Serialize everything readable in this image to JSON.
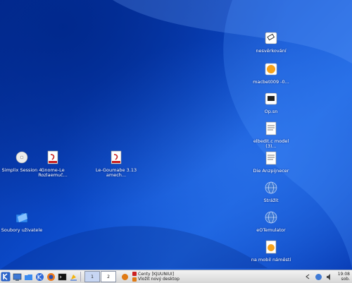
{
  "desktop": {
    "icons": [
      {
        "id": "dvd",
        "name": "dvd-drive-icon",
        "label": "Simplix Session 4",
        "color": "#e8e8e8"
      },
      {
        "id": "pdf1",
        "name": "pdf-document-icon",
        "label": "Gnome-Le Rozlaemuč...",
        "color": "#c81e1e"
      },
      {
        "id": "pdf2",
        "name": "pdf-document-icon",
        "label": "Le-Goumabe 3.13 amech...",
        "color": "#c81e1e"
      },
      {
        "id": "folder",
        "name": "folder-icon",
        "label": "Soubory uživatele",
        "color": "#4aa0ff"
      },
      {
        "id": "eraser",
        "name": "eraser-app-icon",
        "label": "nesvěrkování",
        "color": "#ffffff"
      },
      {
        "id": "mac",
        "name": "hand-document-icon",
        "label": "macbet009 -0...",
        "color": "#f6a21a"
      },
      {
        "id": "disk",
        "name": "disk-image-icon",
        "label": "Op.sn",
        "color": "#ffffff"
      },
      {
        "id": "text1",
        "name": "text-document-icon",
        "label": "elbedit.c model (3)...",
        "color": "#ffffff"
      },
      {
        "id": "text2",
        "name": "text-document-icon",
        "label": "Die Anzpijnecer",
        "color": "#ffffff"
      },
      {
        "id": "globe1",
        "name": "network-globe-icon",
        "label": "Strážit",
        "color": "#3f7ad6"
      },
      {
        "id": "globe2",
        "name": "network-globe-icon",
        "label": "eOTemulator",
        "color": "#3f7ad6"
      },
      {
        "id": "hand",
        "name": "hand-document-icon",
        "label": "na mobil náměstí",
        "color": "#f6a21a"
      }
    ]
  },
  "taskbar": {
    "pager": [
      "1",
      "2"
    ],
    "tasks": [
      {
        "label": "Centy [KJUUNIUI]"
      },
      {
        "label": "Vložit nový desktop"
      }
    ],
    "clock_time": "19:08",
    "clock_date": "sob."
  }
}
